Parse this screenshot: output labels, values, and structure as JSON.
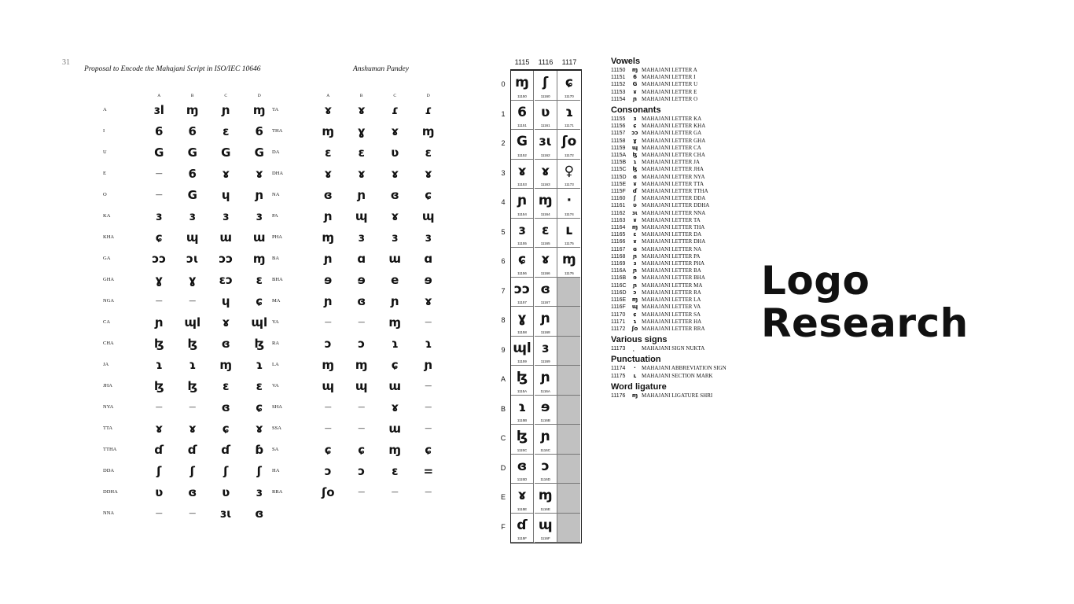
{
  "title": {
    "line1": "Logo",
    "line2": "Research"
  },
  "left_page": {
    "page_number": "31",
    "header_title": "Proposal to Encode the Mahajani Script in ISO/IEC 10646",
    "header_author": "Anshuman Pandey",
    "column_headers": [
      "A",
      "B",
      "C",
      "D"
    ],
    "left_table": [
      {
        "label": "A",
        "glyphs": [
          "ɜl",
          "ɱ",
          "ɲ",
          "ɱ"
        ]
      },
      {
        "label": "I",
        "glyphs": [
          "6",
          "6",
          "ɛ",
          "6"
        ]
      },
      {
        "label": "U",
        "glyphs": [
          "G",
          "G",
          "G",
          "G"
        ]
      },
      {
        "label": "E",
        "glyphs": [
          "—",
          "6",
          "ɤ",
          "ɤ"
        ]
      },
      {
        "label": "O",
        "glyphs": [
          "—",
          "G",
          "ɥ",
          "ɲ"
        ]
      },
      {
        "label": "KA",
        "glyphs": [
          "ɜ",
          "ɜ",
          "ɜ",
          "ɜ"
        ]
      },
      {
        "label": "KHA",
        "glyphs": [
          "ɕ",
          "ɰ",
          "ɯ",
          "ɯ"
        ]
      },
      {
        "label": "GA",
        "glyphs": [
          "ɔɔ",
          "ɔɩ",
          "ɔɔ",
          "ɱ"
        ]
      },
      {
        "label": "GHA",
        "glyphs": [
          "ɣ",
          "ɣ",
          "ɛɔ",
          "ɛ"
        ]
      },
      {
        "label": "NGA",
        "glyphs": [
          "—",
          "—",
          "ɥ",
          "ɕ"
        ]
      },
      {
        "label": "CA",
        "glyphs": [
          "ɲ",
          "ɰl",
          "ɤ",
          "ɰl"
        ]
      },
      {
        "label": "CHA",
        "glyphs": [
          "ɮ",
          "ɮ",
          "ɞ",
          "ɮ"
        ]
      },
      {
        "label": "JA",
        "glyphs": [
          "ɿ",
          "ɿ",
          "ɱ",
          "ɿ"
        ]
      },
      {
        "label": "JHA",
        "glyphs": [
          "ɮ",
          "ɮ",
          "ɛ",
          "ɛ"
        ]
      },
      {
        "label": "NYA",
        "glyphs": [
          "—",
          "—",
          "ɞ",
          "ɕ"
        ]
      },
      {
        "label": "TTA",
        "glyphs": [
          "ɤ",
          "ɤ",
          "ɕ",
          "ɤ"
        ]
      },
      {
        "label": "TTHA",
        "glyphs": [
          "ɗ",
          "ɗ",
          "ɗ",
          "ɓ"
        ]
      },
      {
        "label": "DDA",
        "glyphs": [
          "ʃ",
          "ʃ",
          "ʃ",
          "ʃ"
        ]
      },
      {
        "label": "DDHA",
        "glyphs": [
          "ʋ",
          "ɞ",
          "ʋ",
          "ɜ"
        ]
      },
      {
        "label": "NNA",
        "glyphs": [
          "—",
          "—",
          "ɜɩ",
          "ɞ"
        ]
      }
    ],
    "right_table": [
      {
        "label": "TA",
        "glyphs": [
          "ɤ",
          "ɤ",
          "ɾ",
          "ɾ"
        ]
      },
      {
        "label": "THA",
        "glyphs": [
          "ɱ",
          "ɣ",
          "ɤ",
          "ɱ"
        ]
      },
      {
        "label": "DA",
        "glyphs": [
          "ɛ",
          "ɛ",
          "ʋ",
          "ɛ"
        ]
      },
      {
        "label": "DHA",
        "glyphs": [
          "ɤ",
          "ɤ",
          "ɤ",
          "ɤ"
        ]
      },
      {
        "label": "NA",
        "glyphs": [
          "ɞ",
          "ɲ",
          "ɞ",
          "ɕ"
        ]
      },
      {
        "label": "PA",
        "glyphs": [
          "ɲ",
          "ɰ",
          "ɤ",
          "ɰ"
        ]
      },
      {
        "label": "PHA",
        "glyphs": [
          "ɱ",
          "ɜ",
          "ɜ",
          "ɜ"
        ]
      },
      {
        "label": "BA",
        "glyphs": [
          "ɲ",
          "ɑ",
          "ɯ",
          "ɑ"
        ]
      },
      {
        "label": "BHA",
        "glyphs": [
          "ɘ",
          "ɘ",
          "e",
          "ɘ"
        ]
      },
      {
        "label": "MA",
        "glyphs": [
          "ɲ",
          "ɞ",
          "ɲ",
          "ɤ"
        ]
      },
      {
        "label": "YA",
        "glyphs": [
          "—",
          "—",
          "ɱ",
          "—"
        ]
      },
      {
        "label": "RA",
        "glyphs": [
          "ɔ",
          "ɔ",
          "ɿ",
          "ɿ"
        ]
      },
      {
        "label": "LA",
        "glyphs": [
          "ɱ",
          "ɱ",
          "ɕ",
          "ɲ"
        ]
      },
      {
        "label": "VA",
        "glyphs": [
          "ɰ",
          "ɰ",
          "ɯ",
          "—"
        ]
      },
      {
        "label": "SHA",
        "glyphs": [
          "—",
          "—",
          "ɤ",
          "—"
        ]
      },
      {
        "label": "SSA",
        "glyphs": [
          "—",
          "—",
          "ɯ",
          "—"
        ]
      },
      {
        "label": "SA",
        "glyphs": [
          "ɕ",
          "ɕ",
          "ɱ",
          "ɕ"
        ]
      },
      {
        "label": "HA",
        "glyphs": [
          "ɔ",
          "ɔ",
          "ɛ",
          "="
        ]
      },
      {
        "label": "RRA",
        "glyphs": [
          "ʃo",
          "—",
          "—",
          "—"
        ]
      }
    ]
  },
  "code_chart": {
    "column_headers": [
      "1115",
      "1116",
      "1117"
    ],
    "row_labels": [
      "0",
      "1",
      "2",
      "3",
      "4",
      "5",
      "6",
      "7",
      "8",
      "9",
      "A",
      "B",
      "C",
      "D",
      "E",
      "F"
    ],
    "columns": [
      [
        {
          "g": "ɱ",
          "c": "11150"
        },
        {
          "g": "6",
          "c": "11151"
        },
        {
          "g": "G",
          "c": "11152"
        },
        {
          "g": "ɤ",
          "c": "11153"
        },
        {
          "g": "ɲ",
          "c": "11154"
        },
        {
          "g": "ɜ",
          "c": "11155"
        },
        {
          "g": "ɕ",
          "c": "11156"
        },
        {
          "g": "ɔɔ",
          "c": "11157"
        },
        {
          "g": "ɣ",
          "c": "11158"
        },
        {
          "g": "ɰl",
          "c": "11159"
        },
        {
          "g": "ɮ",
          "c": "1115A"
        },
        {
          "g": "ɿ",
          "c": "1115B"
        },
        {
          "g": "ɮ",
          "c": "1115C"
        },
        {
          "g": "ɞ",
          "c": "1115D"
        },
        {
          "g": "ɤ",
          "c": "1115E"
        },
        {
          "g": "ɗ",
          "c": "1115F"
        }
      ],
      [
        {
          "g": "ʃ",
          "c": "11160"
        },
        {
          "g": "ʋ",
          "c": "11161"
        },
        {
          "g": "ɜɩ",
          "c": "11162"
        },
        {
          "g": "ɤ",
          "c": "11163"
        },
        {
          "g": "ɱ",
          "c": "11164"
        },
        {
          "g": "ɛ",
          "c": "11165"
        },
        {
          "g": "ɤ",
          "c": "11166"
        },
        {
          "g": "ɞ",
          "c": "11167"
        },
        {
          "g": "ɲ",
          "c": "11168"
        },
        {
          "g": "ɜ",
          "c": "11169"
        },
        {
          "g": "ɲ",
          "c": "1116A"
        },
        {
          "g": "ɘ",
          "c": "1116B"
        },
        {
          "g": "ɲ",
          "c": "1116C"
        },
        {
          "g": "ɔ",
          "c": "1116D"
        },
        {
          "g": "ɱ",
          "c": "1116E"
        },
        {
          "g": "ɰ",
          "c": "1116F"
        }
      ],
      [
        {
          "g": "ɕ",
          "c": "11170"
        },
        {
          "g": "ɿ",
          "c": "11171"
        },
        {
          "g": "ʃo",
          "c": "11172"
        },
        {
          "g": "♀",
          "c": "11173"
        },
        {
          "g": "·",
          "c": "11174"
        },
        {
          "g": "ʟ",
          "c": "11175"
        },
        {
          "g": "ɱ",
          "c": "11176"
        }
      ]
    ]
  },
  "name_list": [
    {
      "title": "Vowels",
      "entries": [
        {
          "code": "11150",
          "glyph": "ɱ",
          "name": "MAHAJANI LETTER A"
        },
        {
          "code": "11151",
          "glyph": "6",
          "name": "MAHAJANI LETTER I"
        },
        {
          "code": "11152",
          "glyph": "G",
          "name": "MAHAJANI LETTER U"
        },
        {
          "code": "11153",
          "glyph": "ɤ",
          "name": "MAHAJANI LETTER E"
        },
        {
          "code": "11154",
          "glyph": "ɲ",
          "name": "MAHAJANI LETTER O"
        }
      ]
    },
    {
      "title": "Consonants",
      "entries": [
        {
          "code": "11155",
          "glyph": "ɜ",
          "name": "MAHAJANI LETTER KA"
        },
        {
          "code": "11156",
          "glyph": "ɕ",
          "name": "MAHAJANI LETTER KHA"
        },
        {
          "code": "11157",
          "glyph": "ɔɔ",
          "name": "MAHAJANI LETTER GA"
        },
        {
          "code": "11158",
          "glyph": "ɣ",
          "name": "MAHAJANI LETTER GHA"
        },
        {
          "code": "11159",
          "glyph": "ɰ",
          "name": "MAHAJANI LETTER CA"
        },
        {
          "code": "1115A",
          "glyph": "ɮ",
          "name": "MAHAJANI LETTER CHA"
        },
        {
          "code": "1115B",
          "glyph": "ɿ",
          "name": "MAHAJANI LETTER JA"
        },
        {
          "code": "1115C",
          "glyph": "ɮ",
          "name": "MAHAJANI LETTER JHA"
        },
        {
          "code": "1115D",
          "glyph": "ɞ",
          "name": "MAHAJANI LETTER NYA"
        },
        {
          "code": "1115E",
          "glyph": "ɤ",
          "name": "MAHAJANI LETTER TTA"
        },
        {
          "code": "1115F",
          "glyph": "ɗ",
          "name": "MAHAJANI LETTER TTHA"
        },
        {
          "code": "11160",
          "glyph": "ʃ",
          "name": "MAHAJANI LETTER DDA"
        },
        {
          "code": "11161",
          "glyph": "ʋ",
          "name": "MAHAJANI LETTER DDHA"
        },
        {
          "code": "11162",
          "glyph": "ɜɩ",
          "name": "MAHAJANI LETTER NNA"
        },
        {
          "code": "11163",
          "glyph": "ɤ",
          "name": "MAHAJANI LETTER TA"
        },
        {
          "code": "11164",
          "glyph": "ɱ",
          "name": "MAHAJANI LETTER THA"
        },
        {
          "code": "11165",
          "glyph": "ɛ",
          "name": "MAHAJANI LETTER DA"
        },
        {
          "code": "11166",
          "glyph": "ɤ",
          "name": "MAHAJANI LETTER DHA"
        },
        {
          "code": "11167",
          "glyph": "ɞ",
          "name": "MAHAJANI LETTER NA"
        },
        {
          "code": "11168",
          "glyph": "ɲ",
          "name": "MAHAJANI LETTER PA"
        },
        {
          "code": "11169",
          "glyph": "ɜ",
          "name": "MAHAJANI LETTER PHA"
        },
        {
          "code": "1116A",
          "glyph": "ɲ",
          "name": "MAHAJANI LETTER BA"
        },
        {
          "code": "1116B",
          "glyph": "ɘ",
          "name": "MAHAJANI LETTER BHA"
        },
        {
          "code": "1116C",
          "glyph": "ɲ",
          "name": "MAHAJANI LETTER MA"
        },
        {
          "code": "1116D",
          "glyph": "ɔ",
          "name": "MAHAJANI LETTER RA"
        },
        {
          "code": "1116E",
          "glyph": "ɱ",
          "name": "MAHAJANI LETTER LA"
        },
        {
          "code": "1116F",
          "glyph": "ɰ",
          "name": "MAHAJANI LETTER VA"
        },
        {
          "code": "11170",
          "glyph": "ɕ",
          "name": "MAHAJANI LETTER SA"
        },
        {
          "code": "11171",
          "glyph": "ɿ",
          "name": "MAHAJANI LETTER HA"
        },
        {
          "code": "11172",
          "glyph": "ʃo",
          "name": "MAHAJANI LETTER RRA"
        }
      ]
    },
    {
      "title": "Various signs",
      "entries": [
        {
          "code": "11173",
          "glyph": "̣",
          "name": "MAHAJANI SIGN NUKTA"
        }
      ]
    },
    {
      "title": "Punctuation",
      "entries": [
        {
          "code": "11174",
          "glyph": "·",
          "name": "MAHAJANI ABBREVIATION SIGN"
        },
        {
          "code": "11175",
          "glyph": "ʟ",
          "name": "MAHAJANI SECTION MARK"
        }
      ]
    },
    {
      "title": "Word ligature",
      "entries": [
        {
          "code": "11176",
          "glyph": "ɱ",
          "name": "MAHAJANI LIGATURE SHRI"
        }
      ]
    }
  ]
}
